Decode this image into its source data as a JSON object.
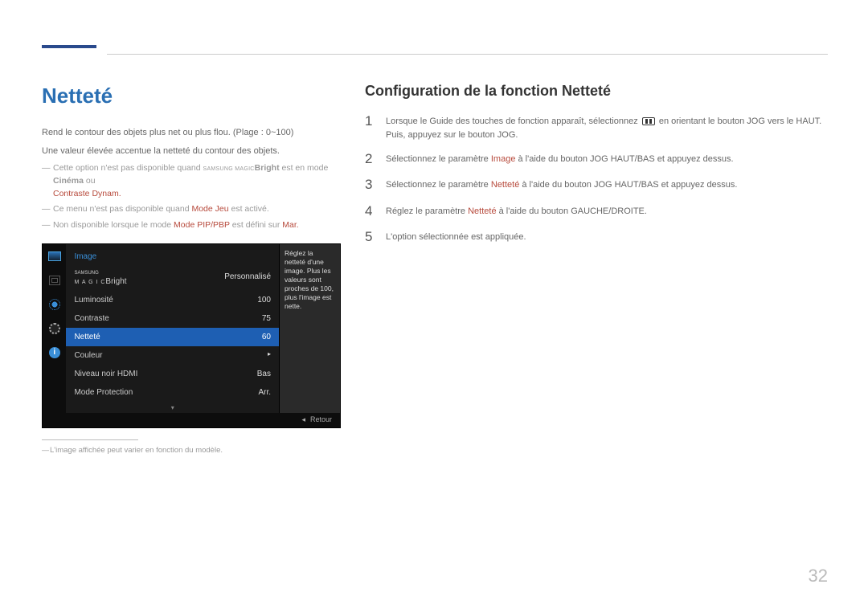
{
  "page_number": "32",
  "left": {
    "title": "Netteté",
    "intro1": "Rend le contour des objets plus net ou plus flou. (Plage : 0~100)",
    "intro2": "Une valeur élevée accentue la netteté du contour des objets.",
    "note1_pre": "Cette option n'est pas disponible quand ",
    "note1_magic": "SAMSUNG MAGIC",
    "note1_bright": "Bright",
    "note1_mid": " est en mode ",
    "note1_cinema": "Cinéma",
    "note1_ou": " ou ",
    "note1_contrast": "Contraste Dynam.",
    "note2_pre": "Ce menu n'est pas disponible quand ",
    "note2_mode": "Mode Jeu",
    "note2_post": " est activé.",
    "note3_pre": "Non disponible lorsque le mode ",
    "note3_mode": "Mode PIP/PBP",
    "note3_mid": " est défini sur ",
    "note3_val": "Mar.",
    "footnote": "L'image affichée peut varier en fonction du modèle."
  },
  "osd": {
    "header": "Image",
    "rows": [
      {
        "label_pre": "SAMSUNG",
        "label_magic": "M A G I C",
        "label_post": "Bright",
        "value": "Personnalisé"
      },
      {
        "label": "Luminosité",
        "value": "100"
      },
      {
        "label": "Contraste",
        "value": "75"
      },
      {
        "label": "Netteté",
        "value": "60",
        "selected": true
      },
      {
        "label": "Couleur",
        "value": ""
      },
      {
        "label": "Niveau noir HDMI",
        "value": "Bas"
      },
      {
        "label": "Mode Protection",
        "value": "Arr."
      }
    ],
    "tip": "Réglez la netteté d'une image. Plus les valeurs sont proches de 100, plus l'image est nette.",
    "back": "Retour"
  },
  "right": {
    "title": "Configuration de la fonction Netteté",
    "steps": [
      {
        "n": "1",
        "pre": "Lorsque le Guide des touches de fonction apparaît, sélectionnez ",
        "post": " en orientant le bouton JOG vers le HAUT. Puis, appuyez sur le bouton JOG."
      },
      {
        "n": "2",
        "pre": "Sélectionnez le paramètre ",
        "hl": "Image",
        "post": " à l'aide du bouton JOG HAUT/BAS et appuyez dessus."
      },
      {
        "n": "3",
        "pre": "Sélectionnez le paramètre ",
        "hl": "Netteté",
        "post": " à l'aide du bouton JOG HAUT/BAS et appuyez dessus."
      },
      {
        "n": "4",
        "pre": "Réglez le paramètre ",
        "hl": "Netteté",
        "post": " à l'aide du bouton GAUCHE/DROITE."
      },
      {
        "n": "5",
        "pre": "L'option sélectionnée est appliquée.",
        "hl": "",
        "post": ""
      }
    ]
  }
}
